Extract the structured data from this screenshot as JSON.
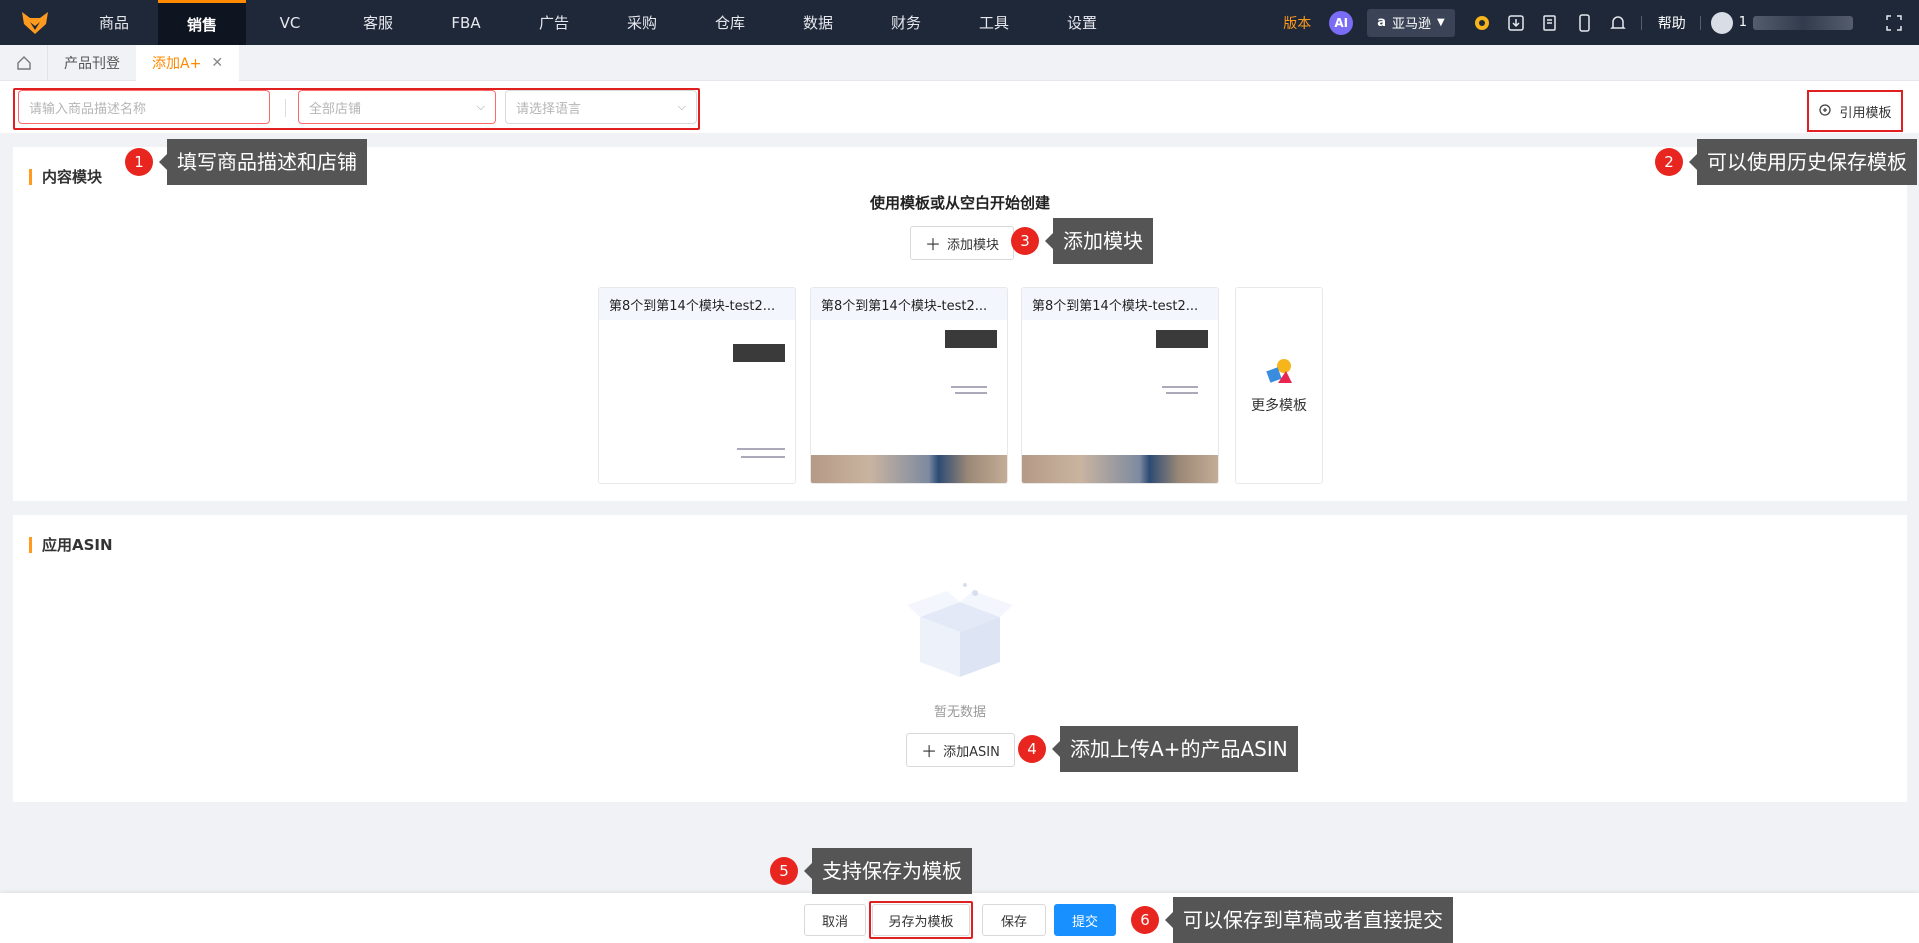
{
  "nav": {
    "items": [
      "商品",
      "销售",
      "VC",
      "客服",
      "FBA",
      "广告",
      "采购",
      "仓库",
      "数据",
      "财务",
      "工具",
      "设置"
    ],
    "active": "销售",
    "version": "版本",
    "ai": "AI",
    "platform": "亚马逊",
    "help": "帮助",
    "user_initial": "1"
  },
  "tabs": {
    "items": [
      {
        "label": "产品刊登"
      },
      {
        "label": "添加A+"
      }
    ]
  },
  "filters": {
    "name_placeholder": "请输入商品描述名称",
    "shop_value": "全部店铺",
    "language_placeholder": "请选择语言",
    "reference_template": "引用模板"
  },
  "content_section": {
    "title": "内容模块",
    "subtitle": "使用模板或从空白开始创建",
    "add_module": "添加模块",
    "templates": [
      {
        "name": "第8个到第14个模块-test2..."
      },
      {
        "name": "第8个到第14个模块-test2..."
      },
      {
        "name": "第8个到第14个模块-test2..."
      }
    ],
    "more_templates": "更多模板"
  },
  "asin_section": {
    "title": "应用ASIN",
    "empty": "暂无数据",
    "add_asin": "添加ASIN"
  },
  "footer": {
    "cancel": "取消",
    "save_as_template": "另存为模板",
    "save": "保存",
    "submit": "提交"
  },
  "annotations": [
    {
      "num": "1",
      "text": "填写商品描述和店铺"
    },
    {
      "num": "2",
      "text": "可以使用历史保存模板"
    },
    {
      "num": "3",
      "text": "添加模块"
    },
    {
      "num": "4",
      "text": "添加上传A+的产品ASIN"
    },
    {
      "num": "5",
      "text": "支持保存为模板"
    },
    {
      "num": "6",
      "text": "可以保存到草稿或者直接提交"
    }
  ],
  "colors": {
    "nav_bg": "#1f2838",
    "accent": "#ff8a00",
    "primary": "#1890ff",
    "annotation_red": "#e8261f"
  }
}
